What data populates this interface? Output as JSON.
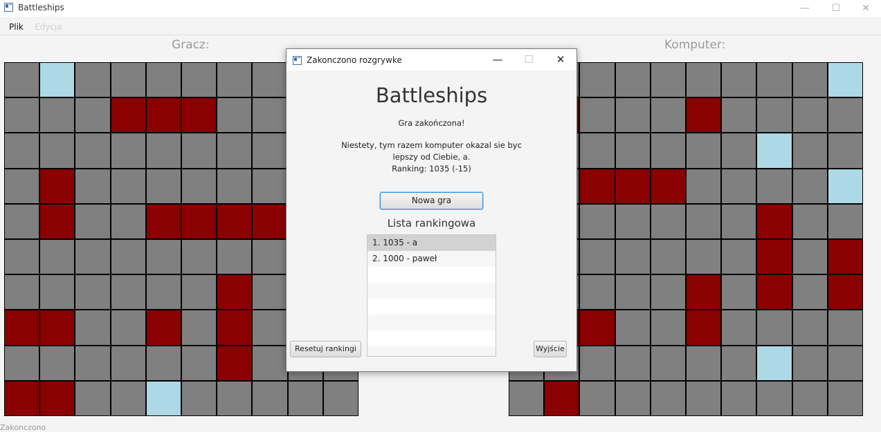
{
  "window": {
    "title": "Battleships",
    "icon": "app-window-icon",
    "controls": {
      "minimize": "—",
      "maximize": "☐",
      "close": "✕"
    }
  },
  "menu": {
    "items": [
      "Plik",
      "Edycja"
    ]
  },
  "player_board": {
    "label": "Gracz:",
    "rows": [
      "EMEEEEEEEE",
      "EEEHHHEEEE",
      "EEEEEEEEEE",
      "EHEEEEEEEE",
      "EHEEHHHHEE",
      "EEEEEEEEEE",
      "EEEEEEHEEE",
      "HHEEHEHEEE",
      "EEEEEEHEEE",
      "HHEEMEEEEE"
    ]
  },
  "computer_board": {
    "label": "Komputer:",
    "rows": [
      "EEEEEEEEEM",
      "EHEEEHEEEE",
      "EEEEEEEMEE",
      "EEHHHEEEEM",
      "EEEEEEEHEE",
      "EEEEEEEHEH",
      "EEEEEHEHEH",
      "EHHEEHEEEE",
      "EEEEEEEMEE",
      "EHEEEEEEEE"
    ]
  },
  "legend_colors": {
    "empty": "#808080",
    "hit": "#8b0000",
    "miss": "#add8e6"
  },
  "status": "Zakonczono",
  "dialog": {
    "title": "Zakonczono rozgrywke",
    "controls": {
      "minimize": "—",
      "maximize": "☐",
      "close": "✕"
    },
    "heading": "Battleships",
    "subtitle": "Gra zakończona!",
    "message_lines": [
      "Niestety, tym razem komputer okazal sie byc",
      "lepszy od Ciebie, a.",
      "Ranking: 1035 (-15)"
    ],
    "new_game_button": "Nowa gra",
    "ranking_title": "Lista rankingowa",
    "ranking": [
      {
        "text": "1. 1035 - a",
        "selected": true
      },
      {
        "text": "2. 1000 - paweł",
        "selected": false
      }
    ],
    "reset_button": "Resetuj rankingi",
    "exit_button": "Wyjście"
  }
}
